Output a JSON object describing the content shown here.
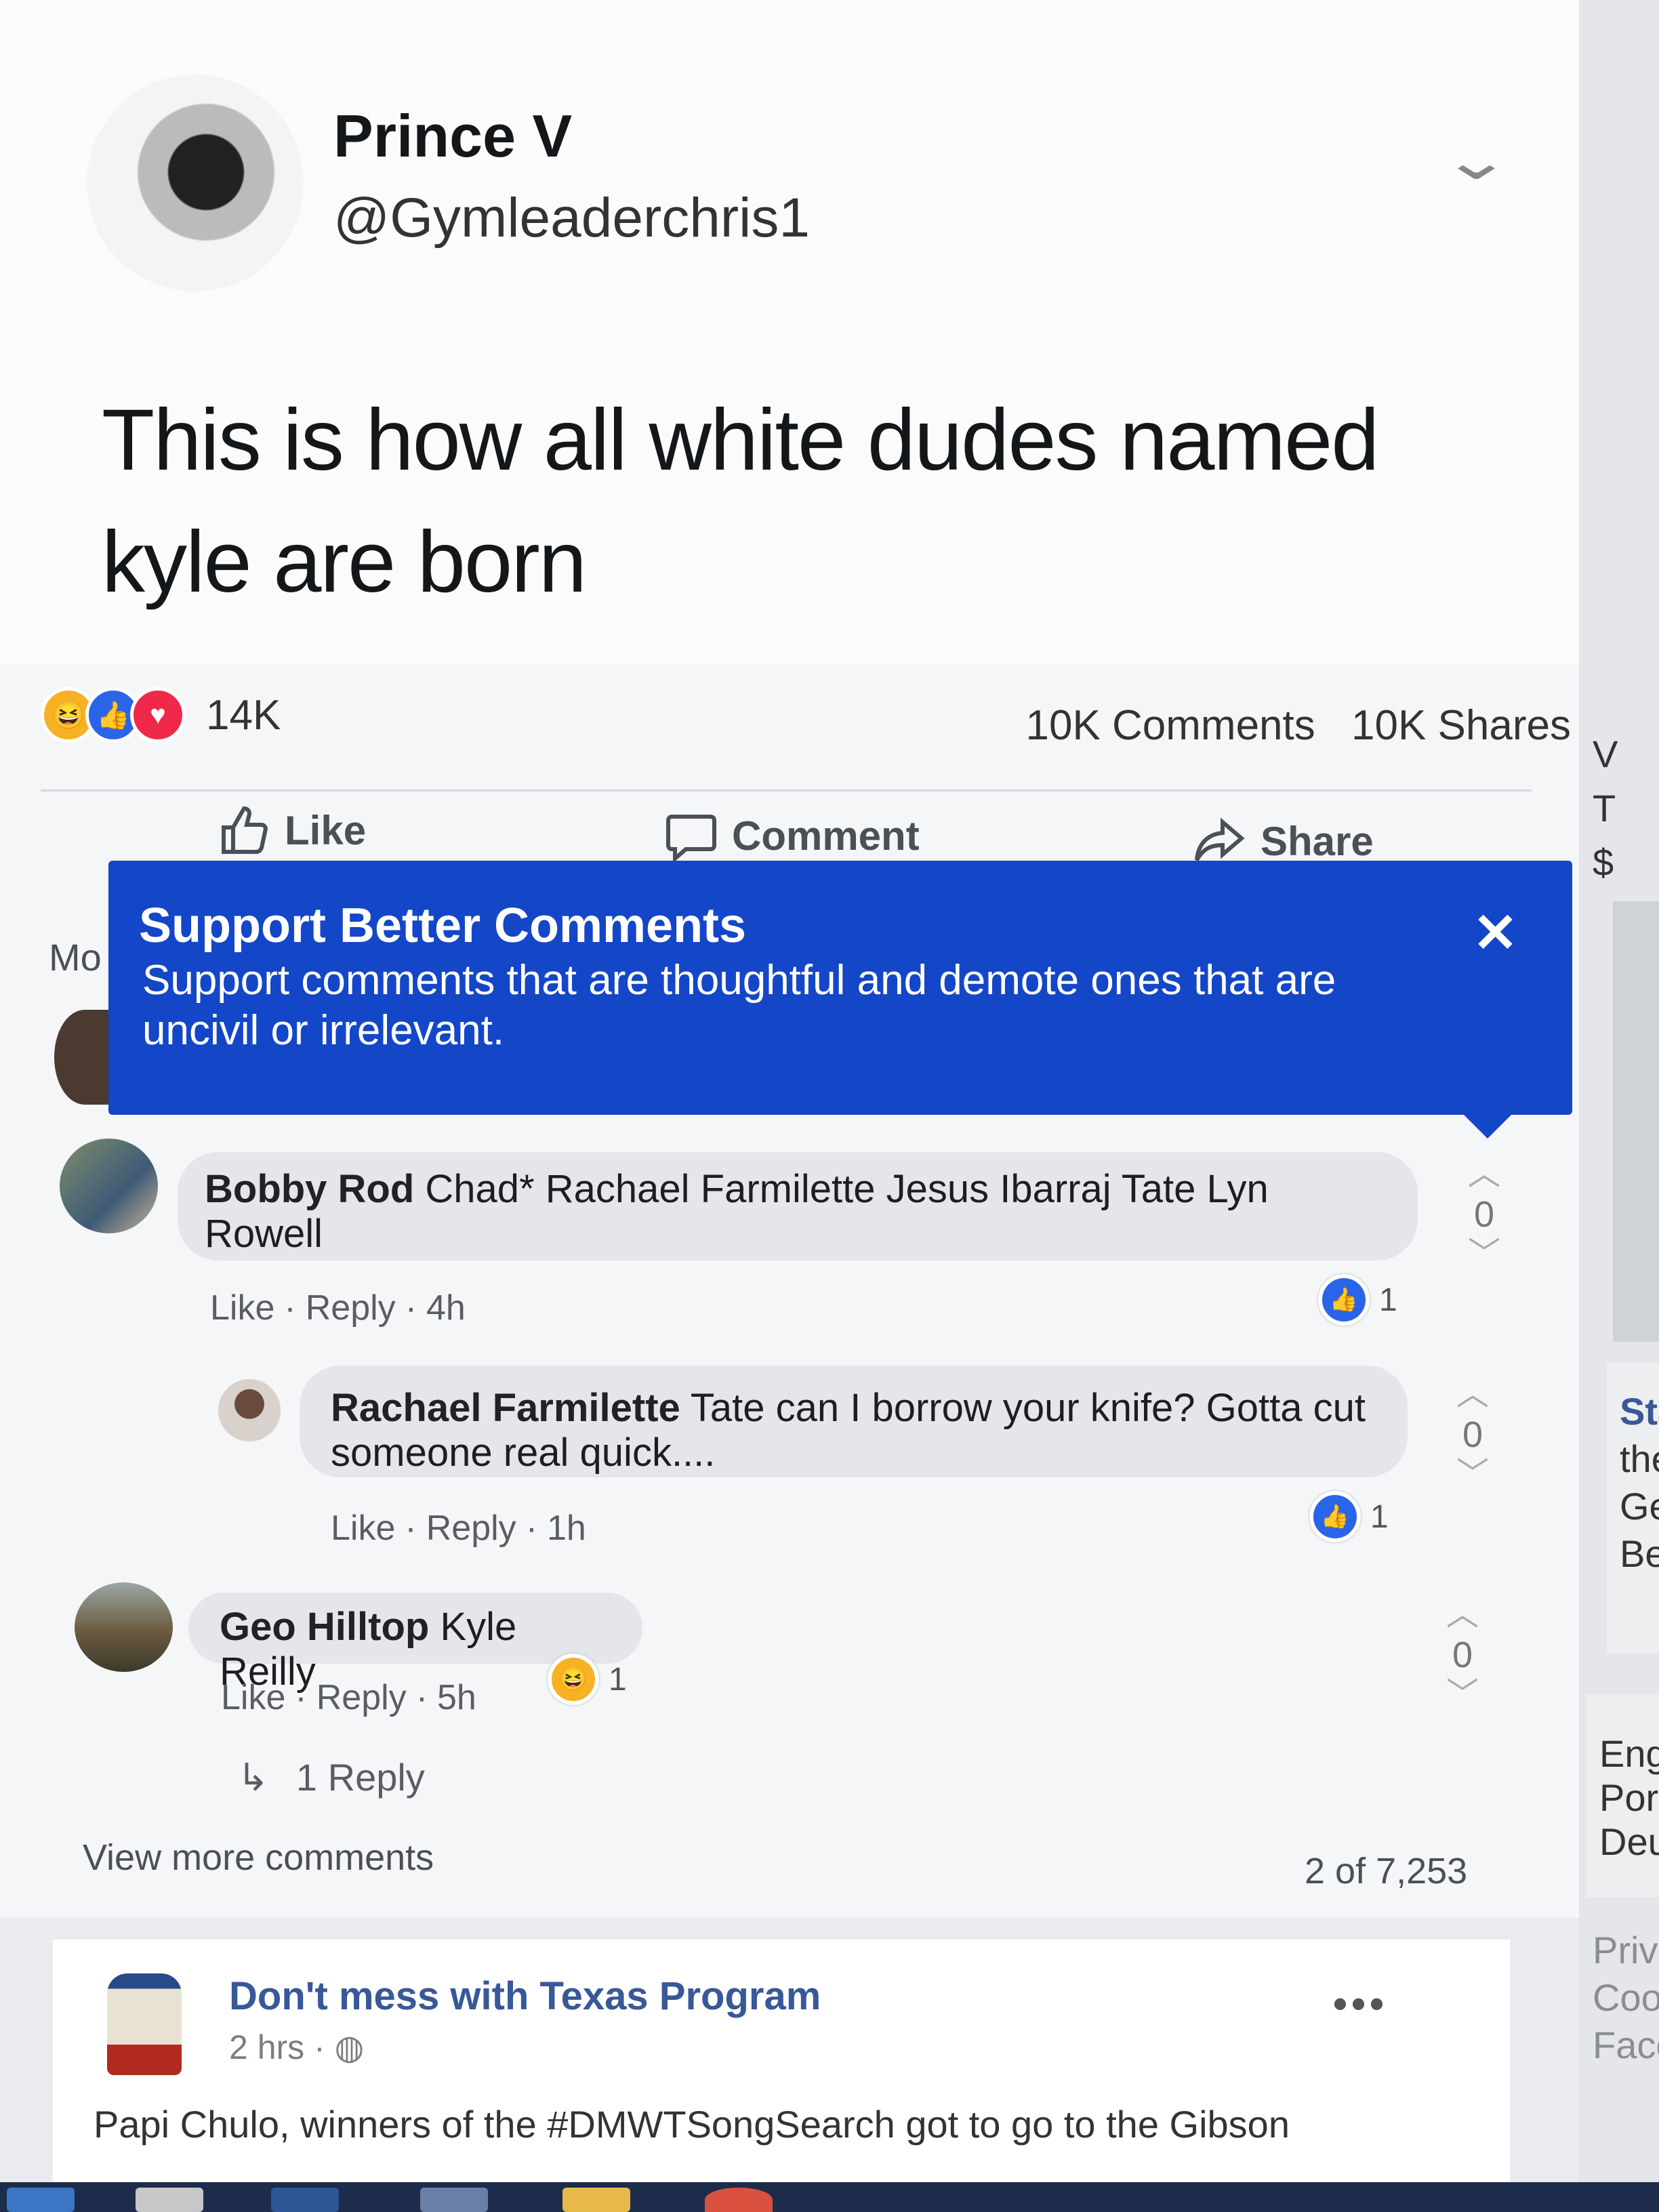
{
  "tweet": {
    "name": "Prince V",
    "handle": "@Gymleaderchris1",
    "text_line1": "This is how all white dudes named",
    "text_line2": "kyle are born"
  },
  "post_stats": {
    "reaction_count": "14K",
    "comments": "10K Comments",
    "shares": "10K Shares"
  },
  "actions": {
    "like": "Like",
    "comment": "Comment",
    "share": "Share"
  },
  "banner": {
    "title": "Support Better Comments",
    "body": "Support comments that are thoughtful and demote ones that are uncivil or irrelevant.",
    "close": "✕"
  },
  "partial_label": "Mo",
  "comments": [
    {
      "author": "Bobby Rod",
      "text_line1": " Chad* Rachael Farmilette Jesus Ibarraj Tate Lyn",
      "text_line2": "Rowell",
      "like": "Like",
      "reply": "Reply",
      "time": "4h",
      "reactions": "1",
      "votes": "0"
    },
    {
      "author": "Rachael Farmilette",
      "text_line1": " Tate can I borrow your knife? Gotta cut",
      "text_line2": "someone real quick....",
      "like": "Like",
      "reply": "Reply",
      "time": "1h",
      "reactions": "1",
      "votes": "0"
    },
    {
      "author": "Geo Hilltop",
      "text_line1": " Kyle Reilly",
      "like": "Like",
      "reply": "Reply",
      "time": "5h",
      "reactions": "1",
      "votes": "0",
      "replies_link": "1 Reply"
    }
  ],
  "view_more": "View more comments",
  "pagination": "2 of 7,253",
  "post2": {
    "name": "Don't mess with Texas Program",
    "time": "2 hrs",
    "text": "Papi Chulo, winners of the #DMWTSongSearch got to go to the Gibson"
  },
  "right_column": {
    "partial_1": [
      "V",
      "T",
      "$"
    ],
    "partial_2": [
      "Sta",
      "the",
      "Ge",
      "Bec"
    ],
    "partial_3": [
      "Eng",
      "Port",
      "Deut"
    ],
    "partial_4": [
      "Priva",
      "Cook",
      "Face"
    ]
  },
  "colors": {
    "banner_blue": "#1446c8",
    "like_blue": "#2a64e8",
    "love_red": "#f0284a",
    "haha_yellow": "#f7b125",
    "link_blue": "#385898"
  }
}
